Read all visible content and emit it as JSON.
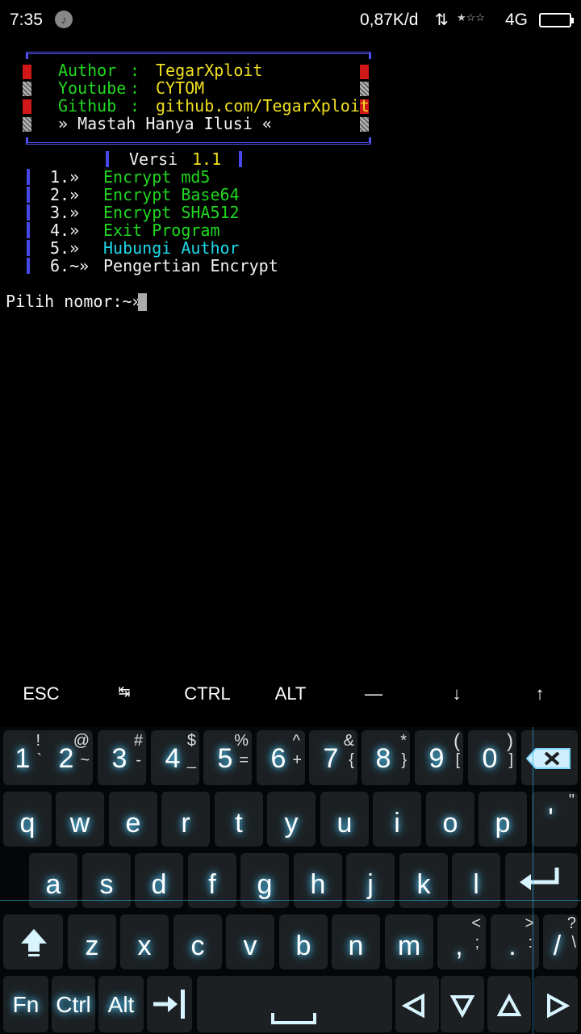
{
  "status_bar": {
    "time": "7:35",
    "speed": "0,87K/d",
    "network": "4G",
    "arrows_icon": "data-transfer-icon"
  },
  "terminal": {
    "banner": {
      "author_label": "Author",
      "author_sep": ":",
      "author_value": "TegarXploit",
      "youtube_label": "Youtube",
      "youtube_sep": ":",
      "youtube_value": "CYTOM",
      "github_label": "Github",
      "github_sep": ":",
      "github_value": "github.com/TegarXploit",
      "motto": "» Mastah Hanya Ilusi «"
    },
    "version_label": "Versi",
    "version_value": "1.1",
    "menu": [
      {
        "num": "1.»",
        "label": "Encrypt md5"
      },
      {
        "num": "2.»",
        "label": "Encrypt Base64"
      },
      {
        "num": "3.»",
        "label": "Encrypt SHA512"
      },
      {
        "num": "4.»",
        "label": "Exit Program"
      },
      {
        "num": "5.»",
        "label": "Hubungi Author"
      },
      {
        "num": "6.~»",
        "label": "Pengertian Encrypt"
      }
    ],
    "prompt": "Pilih nomor:~»"
  },
  "extra_keys": [
    "ESC",
    "↹",
    "CTRL",
    "ALT",
    "—",
    "↓",
    "↑"
  ],
  "keyboard": {
    "row1": [
      {
        "main": "1",
        "sub": "!",
        "sub2": "`"
      },
      {
        "main": "2",
        "sub": "@",
        "sub2": "~"
      },
      {
        "main": "3",
        "sub": "#",
        "sub2": "-"
      },
      {
        "main": "4",
        "sub": "$",
        "sub2": "_"
      },
      {
        "main": "5",
        "sub": "%",
        "sub2": "="
      },
      {
        "main": "6",
        "sub": "^",
        "sub2": "+"
      },
      {
        "main": "7",
        "sub": "&",
        "sub2": "{"
      },
      {
        "main": "8",
        "sub": "*",
        "sub2": "}"
      },
      {
        "main": "9",
        "sub": "(",
        "sub2": "["
      },
      {
        "main": "0",
        "sub": ")",
        "sub2": "]"
      }
    ],
    "backspace_icon": "backspace-icon",
    "row2": [
      {
        "main": "q"
      },
      {
        "main": "w"
      },
      {
        "main": "e"
      },
      {
        "main": "r"
      },
      {
        "main": "t"
      },
      {
        "main": "y"
      },
      {
        "main": "u"
      },
      {
        "main": "i"
      },
      {
        "main": "o"
      },
      {
        "main": "p"
      },
      {
        "main": "'",
        "sub": "\""
      }
    ],
    "row3": [
      {
        "main": "a"
      },
      {
        "main": "s"
      },
      {
        "main": "d"
      },
      {
        "main": "f"
      },
      {
        "main": "g"
      },
      {
        "main": "h"
      },
      {
        "main": "j"
      },
      {
        "main": "k"
      },
      {
        "main": "l"
      }
    ],
    "enter_icon": "enter-icon",
    "shift_icon": "shift-icon",
    "row4": [
      {
        "main": "z"
      },
      {
        "main": "x"
      },
      {
        "main": "c"
      },
      {
        "main": "v"
      },
      {
        "main": "b"
      },
      {
        "main": "n"
      },
      {
        "main": "m"
      },
      {
        "main": ",",
        "sub": "<",
        "sub2": ";"
      },
      {
        "main": ".",
        "sub": ">",
        "sub2": ":"
      },
      {
        "main": "/",
        "sub": "?",
        "sub2": "\\"
      }
    ],
    "row5": {
      "fn": "Fn",
      "ctrl": "Ctrl",
      "alt": "Alt",
      "tab_icon": "tab-icon",
      "space_icon": "space-icon",
      "left_icon": "arrow-left-icon",
      "down_icon": "arrow-down-icon",
      "up_icon": "arrow-up-icon",
      "right_icon": "arrow-right-icon"
    }
  }
}
